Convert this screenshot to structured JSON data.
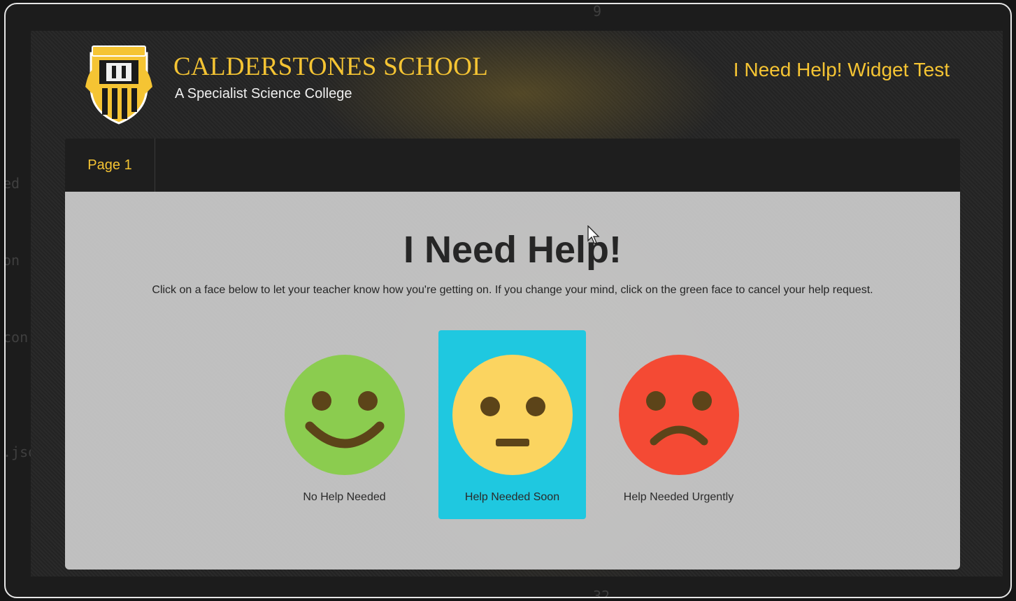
{
  "header": {
    "school_name": "CALDERSTONES SCHOOL",
    "school_subtitle": "A Specialist Science College",
    "widget_title": "I Need Help! Widget Test",
    "crest_label": "CALDERSTONES"
  },
  "nav": {
    "tabs": [
      {
        "label": "Page 1"
      }
    ]
  },
  "main": {
    "heading": "I Need Help!",
    "instructions": "Click on a face below to let your teacher know how you're getting on. If you change your mind, click on the green face to cancel your help request.",
    "options": [
      {
        "label": "No Help Needed",
        "face": "happy-face-icon",
        "color": "#8bcc4f",
        "selected": false
      },
      {
        "label": "Help Needed Soon",
        "face": "neutral-face-icon",
        "color": "#fbd460",
        "selected": true
      },
      {
        "label": "Help Needed Urgently",
        "face": "sad-face-icon",
        "color": "#f44a34",
        "selected": false
      }
    ]
  },
  "colors": {
    "accent": "#f5c433",
    "selected_highlight": "#1fc8e0",
    "feature_dark": "#5c4419"
  }
}
